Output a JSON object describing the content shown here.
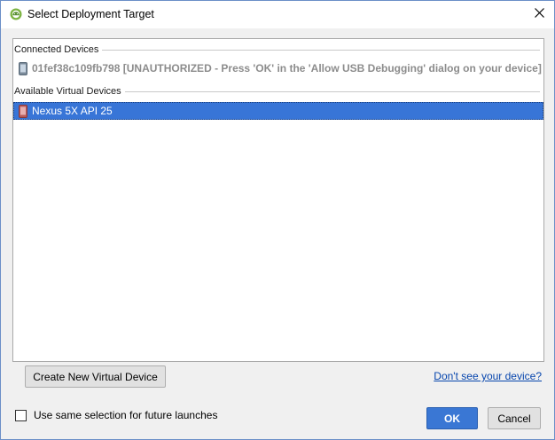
{
  "window": {
    "title": "Select Deployment Target",
    "accent_color": "#3875d7"
  },
  "icons": {
    "app": "android-studio-icon",
    "close": "close-icon",
    "device": "phone-icon",
    "virtual_device": "virtual-phone-icon"
  },
  "list": {
    "connected_header": "Connected Devices",
    "connected_devices": [
      {
        "label": "01fef38c109fb798 [UNAUTHORIZED - Press 'OK' in the 'Allow USB Debugging' dialog on your device]",
        "state": "disabled"
      }
    ],
    "virtual_header": "Available Virtual Devices",
    "virtual_devices": [
      {
        "label": "Nexus 5X API 25",
        "state": "selected"
      }
    ]
  },
  "actions": {
    "create_virtual_device": "Create New Virtual Device",
    "dont_see_device": "Don't see your device?",
    "same_selection": "Use same selection for future launches",
    "same_selection_checked": false,
    "ok": "OK",
    "cancel": "Cancel"
  }
}
